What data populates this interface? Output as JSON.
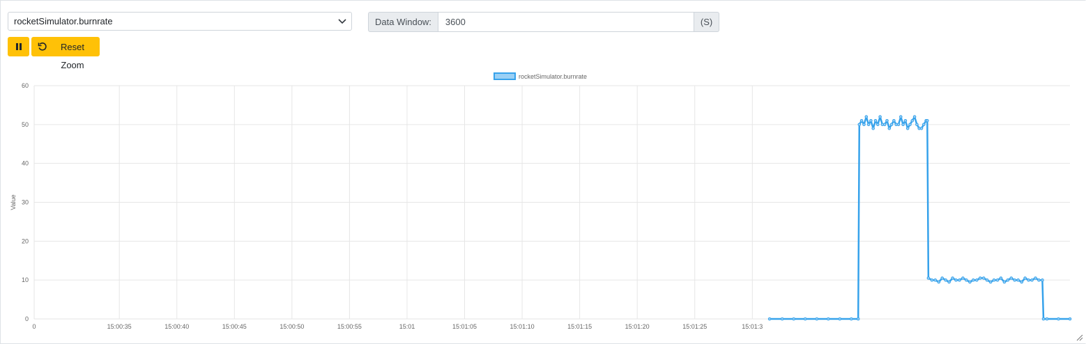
{
  "selector": {
    "value": "rocketSimulator.burnrate"
  },
  "data_window": {
    "label": "Data Window:",
    "value": "3600",
    "unit": "(S)"
  },
  "toolbar": {
    "pause_icon": "pause-icon",
    "reset_label": "Reset Zoom",
    "reset_icon": "undo-icon"
  },
  "colors": {
    "accent": "#ffc107",
    "series": "#36a2eb",
    "series_fill": "#9ad0f5",
    "grid": "#e6e6e6",
    "text": "#666666"
  },
  "chart_data": {
    "type": "line",
    "title": "",
    "ylabel": "Value",
    "xlabel": "",
    "ylim": [
      0,
      60
    ],
    "yticks": [
      "0",
      "10",
      "20",
      "30",
      "40",
      "50",
      "60"
    ],
    "xticks": [
      "0",
      "15:00:35",
      "15:00:40",
      "15:00:45",
      "15:00:50",
      "15:00:55",
      "15:01",
      "15:01:05",
      "15:01:10",
      "15:01:15",
      "15:01:20",
      "15:01:25",
      "15:01:3"
    ],
    "legend": {
      "position": "top",
      "entries": [
        "rocketSimulator.burnrate"
      ]
    },
    "grid": true,
    "series": [
      {
        "name": "rocketSimulator.burnrate",
        "x": [
          63.9,
          65,
          66,
          67,
          68,
          69,
          70,
          71,
          71.6,
          71.7,
          71.9,
          72.1,
          72.3,
          72.5,
          72.7,
          72.9,
          73.1,
          73.3,
          73.5,
          73.7,
          73.9,
          74.1,
          74.3,
          74.5,
          74.7,
          74.9,
          75.1,
          75.3,
          75.5,
          75.7,
          75.9,
          76.1,
          76.3,
          76.5,
          76.7,
          76.9,
          77.1,
          77.3,
          77.5,
          77.6,
          77.7,
          78.0,
          78.3,
          78.6,
          78.9,
          79.2,
          79.5,
          79.8,
          80.1,
          80.4,
          80.7,
          81.0,
          81.3,
          81.6,
          81.9,
          82.2,
          82.5,
          82.8,
          83.1,
          83.4,
          83.7,
          84.0,
          84.3,
          84.6,
          84.9,
          85.2,
          85.5,
          85.8,
          86.1,
          86.4,
          86.7,
          87.0,
          87.3,
          87.6,
          87.7,
          88,
          89,
          90
        ],
        "values": [
          0,
          0,
          0,
          0,
          0,
          0,
          0,
          0,
          0,
          50,
          51,
          50,
          52,
          50,
          51,
          49,
          51,
          50,
          52,
          50,
          50,
          51,
          49,
          50,
          51,
          50,
          50,
          52,
          50,
          51,
          49,
          50,
          51,
          52,
          50,
          49,
          49,
          50,
          51,
          51,
          10.5,
          10,
          10,
          9.5,
          10.5,
          10,
          9.5,
          10.5,
          10,
          10,
          10.5,
          10,
          9.5,
          10,
          10,
          10.5,
          10.5,
          10,
          9.5,
          10,
          10,
          10.5,
          9.5,
          10,
          10.5,
          10,
          10,
          9.5,
          10.5,
          10,
          10,
          10.5,
          10,
          10,
          0,
          0,
          0,
          0
        ]
      }
    ]
  }
}
